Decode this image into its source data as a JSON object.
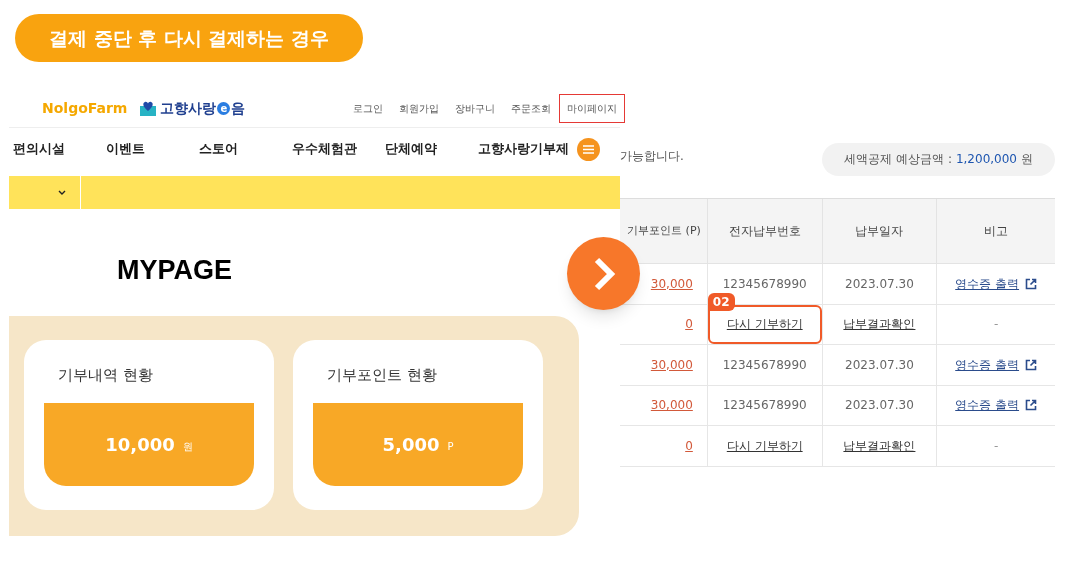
{
  "title_badge": "결제 중단 후 다시 결제하는 경우",
  "left_page": {
    "logo_farm": "NolgoFarm",
    "logo_gohyang": [
      "고향사랑",
      "e",
      "음"
    ],
    "top_links": [
      {
        "label": "로그인",
        "selected": false
      },
      {
        "label": "회원가입",
        "selected": false
      },
      {
        "label": "장바구니",
        "selected": false
      },
      {
        "label": "주문조회",
        "selected": false
      },
      {
        "label": "마이페이지",
        "selected": true
      }
    ],
    "nav": [
      "편의시설",
      "이벤트",
      "스토어",
      "우수체험관",
      "단체예약",
      "고향사랑기부제"
    ],
    "heading": "MYPAGE",
    "cards": [
      {
        "title": "기부내역 현황",
        "value": "10,000",
        "unit": "원"
      },
      {
        "title": "기부포인트 현황",
        "value": "5,000",
        "unit": "P"
      }
    ]
  },
  "right_page": {
    "notice": "가능합니다.",
    "tax_label": "세액공제 예상금액 :",
    "tax_value": "1,200,000",
    "tax_unit": "원",
    "columns": [
      "기부포인트 (P)",
      "전자납부번호",
      "납부일자",
      "비고"
    ],
    "rows": [
      {
        "kind": "paid",
        "points": "30,000",
        "number": "12345678990",
        "date": "2023.07.30",
        "note": "영수증 출력"
      },
      {
        "kind": "retry",
        "points": "0",
        "number": "다시 기부하기",
        "date": "납부결과확인",
        "note": "-",
        "callout": "02"
      },
      {
        "kind": "paid",
        "points": "30,000",
        "number": "12345678990",
        "date": "2023.07.30",
        "note": "영수증 출력"
      },
      {
        "kind": "paid",
        "points": "30,000",
        "number": "12345678990",
        "date": "2023.07.30",
        "note": "영수증 출력"
      },
      {
        "kind": "retry",
        "points": "0",
        "number": "다시 기부하기",
        "date": "납부결과확인",
        "note": "-"
      }
    ]
  }
}
